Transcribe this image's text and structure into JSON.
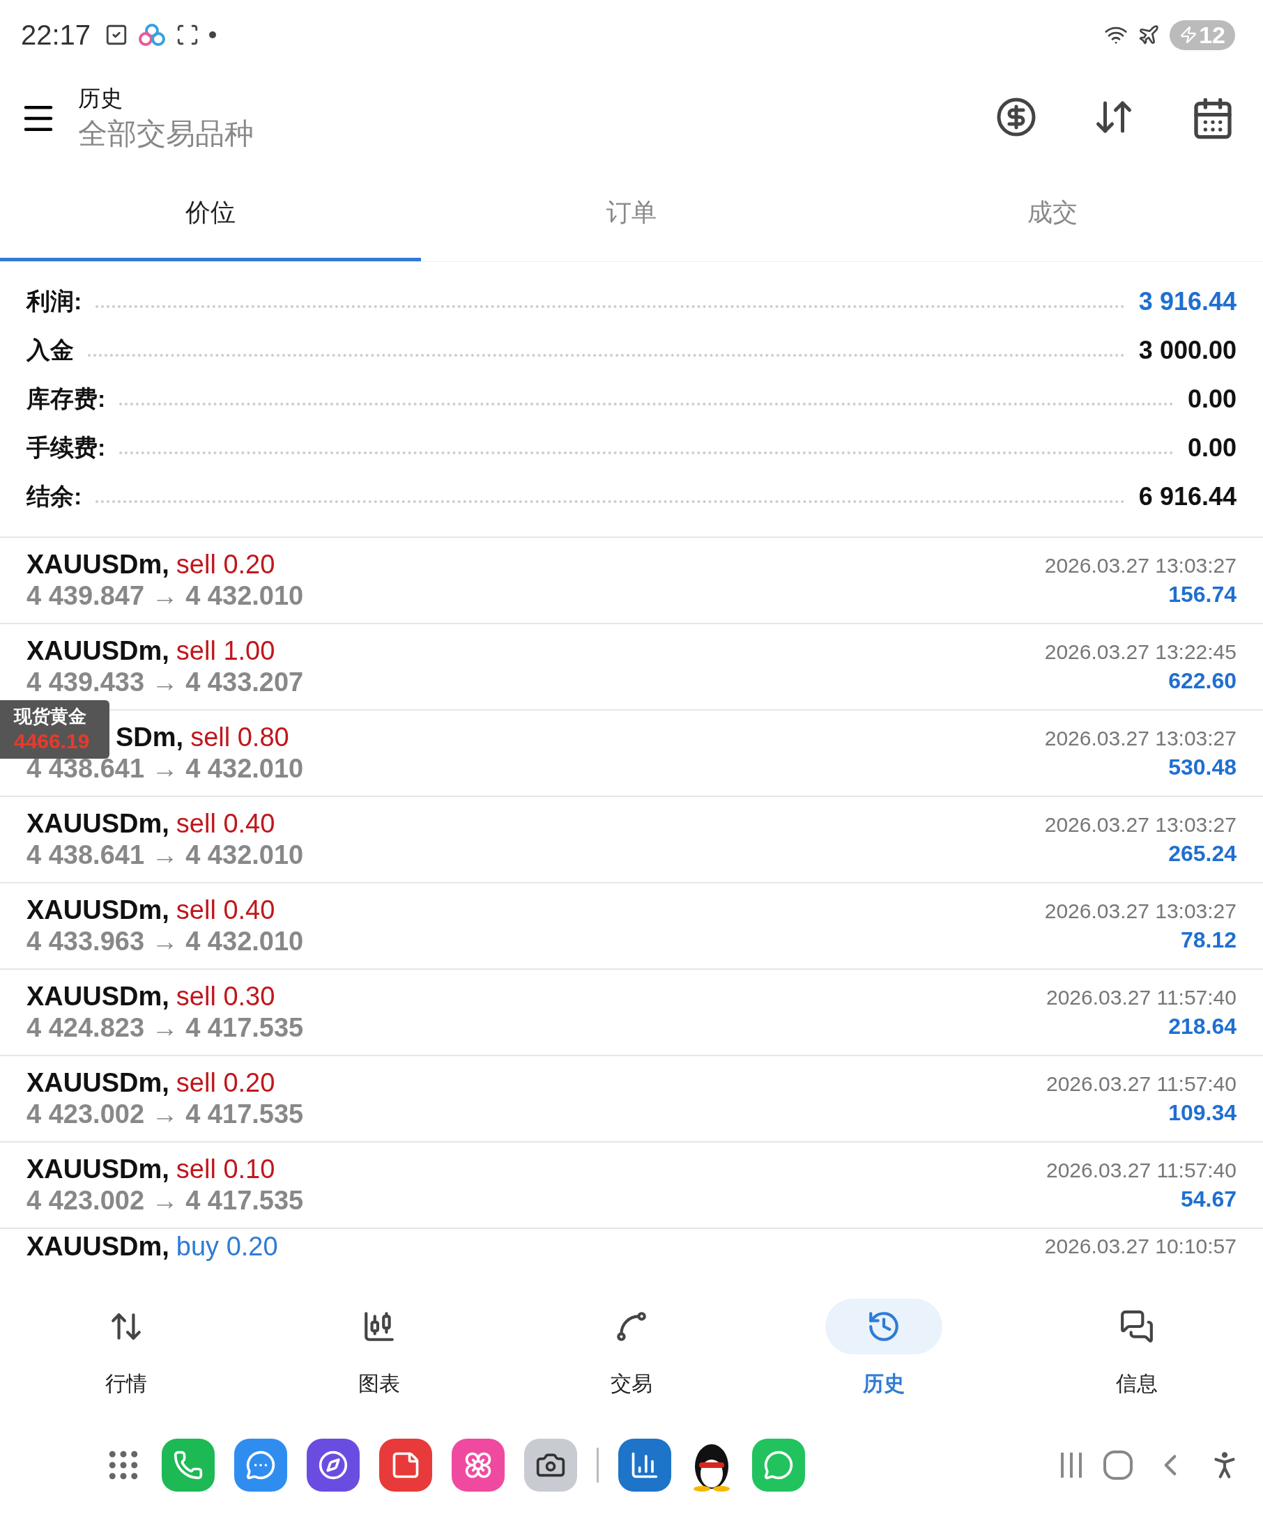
{
  "status_bar": {
    "time": "22:17",
    "battery": "12"
  },
  "header": {
    "title": "历史",
    "subtitle": "全部交易品种"
  },
  "tabs": [
    {
      "label": "价位",
      "selected": true
    },
    {
      "label": "订单",
      "selected": false
    },
    {
      "label": "成交",
      "selected": false
    }
  ],
  "summary": [
    {
      "label": "利润:",
      "value": "3 916.44",
      "emphasized": true
    },
    {
      "label": "入金",
      "value": "3 000.00",
      "emphasized": false
    },
    {
      "label": "库存费:",
      "value": "0.00",
      "emphasized": false
    },
    {
      "label": "手续费:",
      "value": "0.00",
      "emphasized": false
    },
    {
      "label": "结余:",
      "value": "6 916.44",
      "emphasized": false
    }
  ],
  "trades": [
    {
      "symbol": "XAUUSDm,",
      "kind": "sell",
      "side": "sell 0.20",
      "prices": "4 439.847 → 4 432.010",
      "time": "2026.03.27 13:03:27",
      "profit": "156.74"
    },
    {
      "symbol": "XAUUSDm,",
      "kind": "sell",
      "side": "sell 1.00",
      "prices": "4 439.433 → 4 433.207",
      "time": "2026.03.27 13:22:45",
      "profit": "622.60"
    },
    {
      "symbol": "SDm,",
      "covered": true,
      "kind": "sell",
      "side": "sell 0.80",
      "prices": "4 438.641 → 4 432.010",
      "time": "2026.03.27 13:03:27",
      "profit": "530.48"
    },
    {
      "symbol": "XAUUSDm,",
      "kind": "sell",
      "side": "sell 0.40",
      "prices": "4 438.641 → 4 432.010",
      "time": "2026.03.27 13:03:27",
      "profit": "265.24"
    },
    {
      "symbol": "XAUUSDm,",
      "kind": "sell",
      "side": "sell 0.40",
      "prices": "4 433.963 → 4 432.010",
      "time": "2026.03.27 13:03:27",
      "profit": "78.12"
    },
    {
      "symbol": "XAUUSDm,",
      "kind": "sell",
      "side": "sell 0.30",
      "prices": "4 424.823 → 4 417.535",
      "time": "2026.03.27 11:57:40",
      "profit": "218.64"
    },
    {
      "symbol": "XAUUSDm,",
      "kind": "sell",
      "side": "sell 0.20",
      "prices": "4 423.002 → 4 417.535",
      "time": "2026.03.27 11:57:40",
      "profit": "109.34"
    },
    {
      "symbol": "XAUUSDm,",
      "kind": "sell",
      "side": "sell 0.10",
      "prices": "4 423.002 → 4 417.535",
      "time": "2026.03.27 11:57:40",
      "profit": "54.67"
    },
    {
      "symbol": "XAUUSDm,",
      "kind": "buy",
      "side": "buy 0.20",
      "time": "2026.03.27 10:10:57"
    }
  ],
  "price_widget": {
    "title": "现货黄金",
    "price": "4466.19"
  },
  "bottom_nav": [
    {
      "label": "行情",
      "selected": false
    },
    {
      "label": "图表",
      "selected": false
    },
    {
      "label": "交易",
      "selected": false
    },
    {
      "label": "历史",
      "selected": true
    },
    {
      "label": "信息",
      "selected": false
    }
  ]
}
